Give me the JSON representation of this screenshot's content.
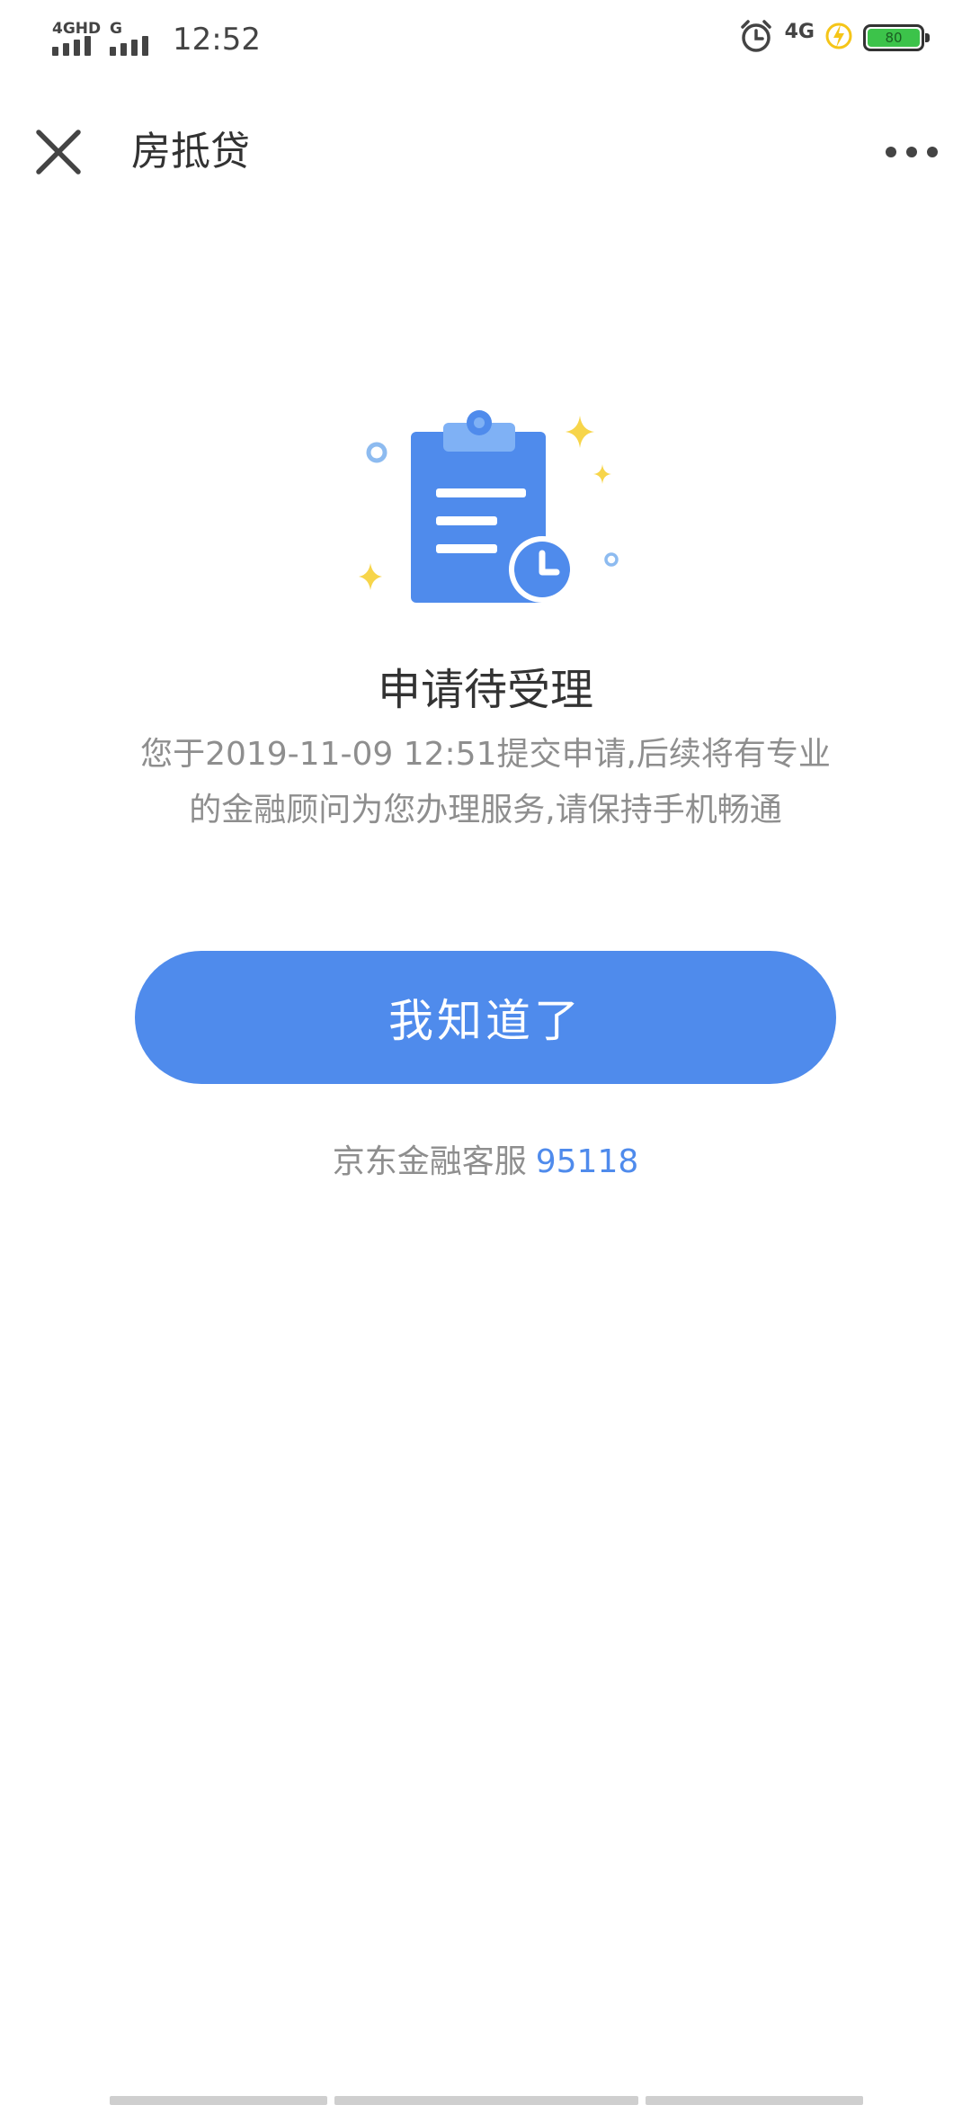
{
  "status_bar": {
    "network1": "4GHD",
    "network2": "G",
    "time": "12:52",
    "network3": "4G",
    "battery_level": "80",
    "colors": {
      "battery": "#3cc34a",
      "charging": "#f5c518"
    },
    "icons": [
      "alarm-clock-icon",
      "charging-icon",
      "battery-icon"
    ]
  },
  "nav": {
    "title": "房抵贷",
    "icons": [
      "close-icon",
      "more-icon"
    ]
  },
  "main": {
    "illustration": "clipboard-clock-icon",
    "title": "申请待受理",
    "description": "您于2019-11-09 12:51提交申请,后续将有专业的金融顾问为您办理服务,请保持手机畅通",
    "button_label": "我知道了",
    "service_label": "京东金融客服",
    "service_phone": "95118"
  },
  "colors": {
    "accent": "#4f8bec",
    "text_primary": "#333333",
    "text_secondary": "#8e8e8e",
    "sparkle": "#f7d54a"
  }
}
